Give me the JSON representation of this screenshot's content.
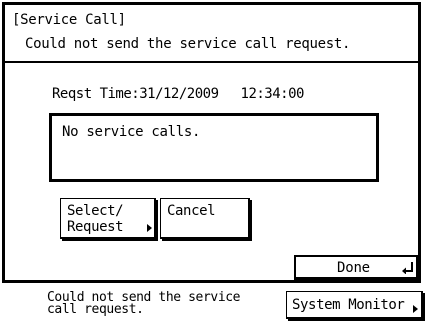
{
  "dialog": {
    "title": "[Service Call]",
    "message": "Could not send the service call request.",
    "request_time_label": "Reqst Time:31/12/2009",
    "request_time_value": "12:34:00",
    "result_text": "No service calls."
  },
  "buttons": {
    "select_request_line1": "Select/",
    "select_request_line2": "Request",
    "cancel": "Cancel",
    "done": "Done"
  },
  "status_bar": {
    "message_line1": "Could not send the service",
    "message_line2": "call request.",
    "system_monitor": "System Monitor"
  }
}
